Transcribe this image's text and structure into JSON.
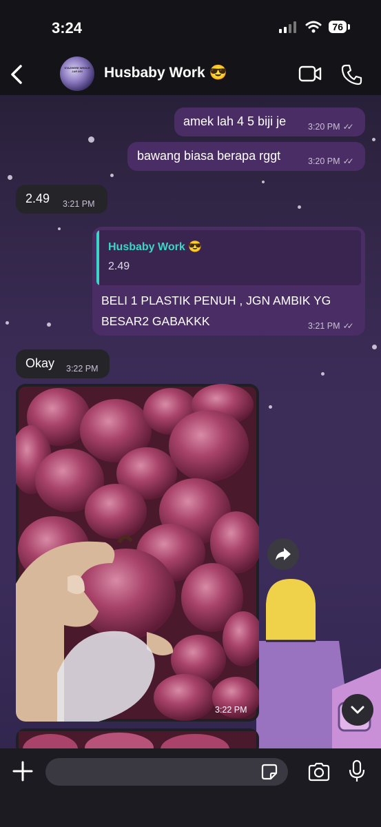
{
  "status_bar": {
    "time": "3:24",
    "battery": "76"
  },
  "header": {
    "contact_name": "Husbaby Work",
    "contact_emoji": "😎",
    "avatar_text": "STAZHERE WHOLE JAR 8G!"
  },
  "messages": [
    {
      "text": "amek lah 4 5 biji je",
      "time": "3:20 PM",
      "ticks": "✓✓"
    },
    {
      "text": "bawang biasa berapa rggt",
      "time": "3:20 PM",
      "ticks": "✓✓"
    },
    {
      "text": "2.49",
      "time": "3:21 PM"
    },
    {
      "quote_name": "Husbaby Work",
      "quote_emoji": "😎",
      "quote_text": "2.49",
      "line1": "BELI 1 PLASTIK PENUH , JGN AMBIK YG",
      "line2": "BESAR2 GABAKKK",
      "time": "3:21 PM",
      "ticks": "✓✓"
    },
    {
      "text": "Okay",
      "time": "3:22 PM"
    },
    {
      "image": "red-onions-photo",
      "time": "3:22 PM"
    }
  ],
  "composer": {
    "placeholder": ""
  },
  "icons": [
    "back-chevron-icon",
    "video-call-icon",
    "phone-call-icon",
    "forward-icon",
    "scroll-down-icon",
    "plus-icon",
    "sticker-icon",
    "camera-icon",
    "microphone-icon"
  ],
  "colors": {
    "outgoing_bubble": "#4a2d64",
    "incoming_bubble": "#242429",
    "quote_accent": "#3ad6c8"
  }
}
